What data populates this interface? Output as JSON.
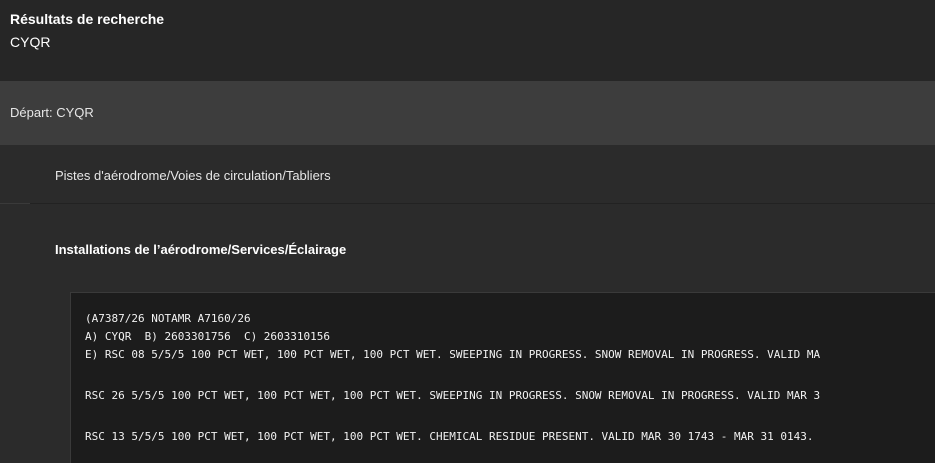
{
  "header": {
    "title": "Résultats de recherche",
    "query": "CYQR"
  },
  "departure": {
    "label": "Départ: CYQR"
  },
  "sections": [
    {
      "label": "Pistes d'aérodrome/Voies de circulation/Tabliers"
    },
    {
      "label": "Installations de l’aérodrome/Services/Éclairage"
    }
  ],
  "notam": {
    "lines": [
      "(A7387/26 NOTAMR A7160/26",
      "A) CYQR  B) 2603301756  C) 2603310156",
      "E) RSC 08 5/5/5 100 PCT WET, 100 PCT WET, 100 PCT WET. SWEEPING IN PROGRESS. SNOW REMOVAL IN PROGRESS. VALID MA",
      "RSC 26 5/5/5 100 PCT WET, 100 PCT WET, 100 PCT WET. SWEEPING IN PROGRESS. SNOW REMOVAL IN PROGRESS. VALID MAR 3",
      "RSC 13 5/5/5 100 PCT WET, 100 PCT WET, 100 PCT WET. CHEMICAL RESIDUE PRESENT. VALID MAR 30 1743 - MAR 31 0143."
    ]
  }
}
